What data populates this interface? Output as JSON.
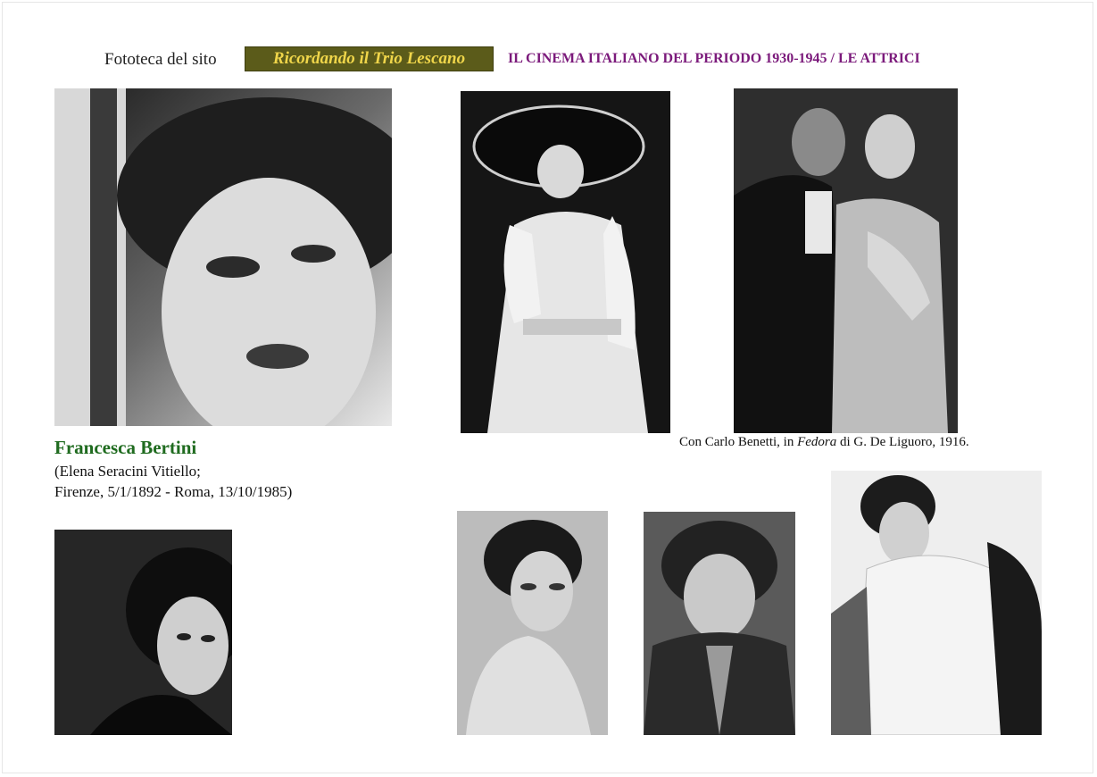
{
  "header": {
    "site_prefix": "Fototeca del sito",
    "site_name": "Ricordando il Trio Lescano",
    "section_title": "IL CINEMA ITALIANO DEL PERIODO 1930-1945 / LE ATTRICI"
  },
  "actress": {
    "name": "Francesca Bertini",
    "bio_line1": "(Elena Seracini Vitiello;",
    "bio_line2": "Firenze, 5/1/1892 - Roma, 13/10/1985)"
  },
  "caption": {
    "prefix": "Con Carlo Benetti, in ",
    "film": "Fedora",
    "suffix": " di G. De Liguoro, 1916."
  },
  "colors": {
    "name": "#1f6b1f",
    "section_title": "#7b1a7b",
    "badge_bg": "#5b5b1a",
    "badge_text": "#f0d64a"
  }
}
